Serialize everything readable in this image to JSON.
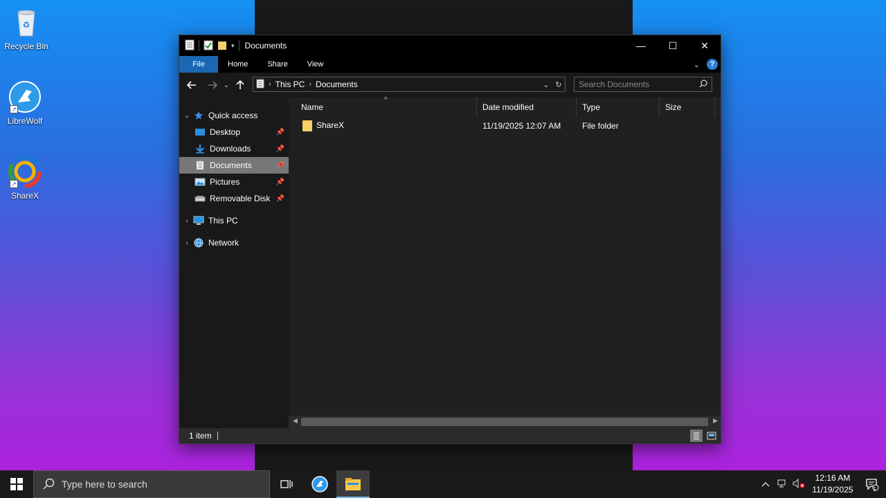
{
  "desktop": {
    "icons": [
      {
        "label": "Recycle Bin",
        "icon": "recycle-bin-icon"
      },
      {
        "label": "LibreWolf",
        "icon": "librewolf-icon"
      },
      {
        "label": "ShareX",
        "icon": "sharex-icon"
      }
    ]
  },
  "window": {
    "title": "Documents",
    "controls": {
      "minimize": "—",
      "maximize": "☐",
      "close": "✕"
    },
    "ribbon": {
      "tabs": [
        "File",
        "Home",
        "Share",
        "View"
      ]
    },
    "address": {
      "crumbs": [
        "This PC",
        "Documents"
      ]
    },
    "search": {
      "placeholder": "Search Documents"
    },
    "nav": {
      "quick_access": "Quick access",
      "items": [
        "Desktop",
        "Downloads",
        "Documents",
        "Pictures",
        "Removable Disk"
      ],
      "this_pc": "This PC",
      "network": "Network"
    },
    "columns": [
      "Name",
      "Date modified",
      "Type",
      "Size"
    ],
    "files": [
      {
        "name": "ShareX",
        "date": "11/19/2025 12:07 AM",
        "type": "File folder",
        "size": ""
      }
    ],
    "status": {
      "count": "1 item"
    }
  },
  "taskbar": {
    "search_placeholder": "Type here to search",
    "time": "12:16 AM",
    "date": "11/19/2025",
    "notification_count": "1"
  },
  "colors": {
    "accent": "#1a68b4",
    "folder": "#f7d06a",
    "window_bg": "#202020"
  }
}
